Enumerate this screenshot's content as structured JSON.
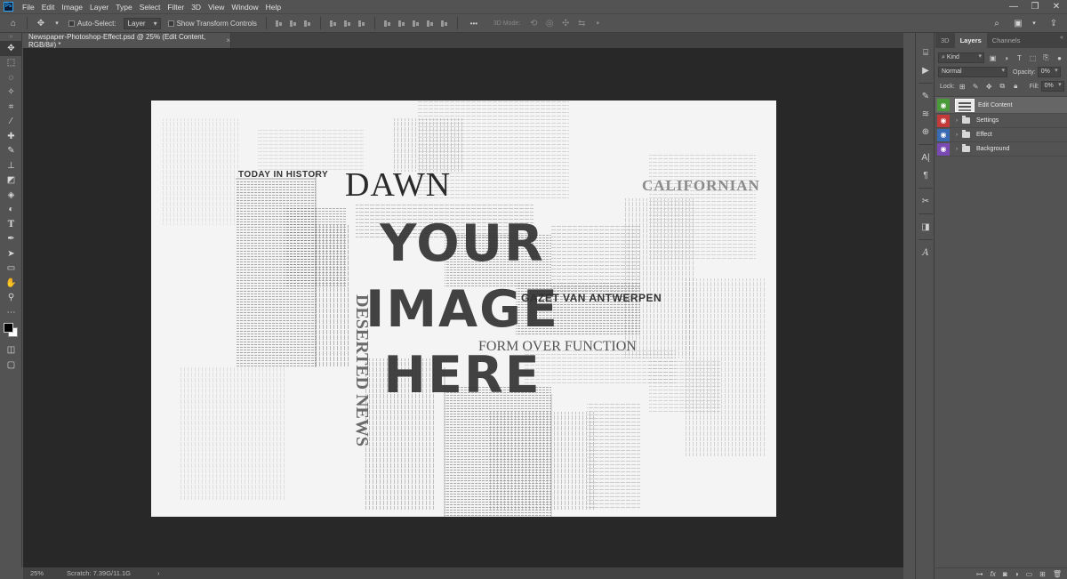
{
  "menu": {
    "app_logo": "Ps",
    "items": [
      "File",
      "Edit",
      "Image",
      "Layer",
      "Type",
      "Select",
      "Filter",
      "3D",
      "View",
      "Window",
      "Help"
    ],
    "window_controls": [
      "—",
      "❐",
      "✕"
    ]
  },
  "options_bar": {
    "auto_select_label": "Auto-Select:",
    "auto_select_target": "Layer",
    "show_transform_label": "Show Transform Controls",
    "mode_3d_label": "3D Mode:",
    "more_label": "•••"
  },
  "document": {
    "tab_title": "Newspaper-Photoshop-Effect.psd @ 25% (Edit Content, RGB/8#) *",
    "close_glyph": "×"
  },
  "canvas_text": {
    "headline_line1": "YOUR",
    "headline_line2": "IMAGE",
    "headline_line3": "HERE",
    "dawn": "DAWN",
    "today_in_history": "TODAY IN HISTORY",
    "californian": "CALIFORNIAN",
    "gazette": "GAZET VAN ANTWERPEN",
    "form_over_function": "FORM OVER FUNCTION",
    "deserted_news": "DESERTED NEWS"
  },
  "status_bar": {
    "zoom": "25%",
    "scratch": "Scratch: 7.39G/11.1G",
    "arrow": "›"
  },
  "layers_panel": {
    "tabs": [
      "3D",
      "Layers",
      "Channels"
    ],
    "active_tab": "Layers",
    "kind_filter": "Kind",
    "blend_mode": "Normal",
    "opacity_label": "Opacity:",
    "opacity_value": "0%",
    "lock_label": "Lock:",
    "fill_label": "Fill:",
    "fill_value": "0%",
    "layers": [
      {
        "name": "Edit Content",
        "type": "smart-object",
        "eye_color": "#4a9a3a",
        "selected": true
      },
      {
        "name": "Settings",
        "type": "group",
        "eye_color": "#c43a3a",
        "selected": false
      },
      {
        "name": "Effect",
        "type": "group",
        "eye_color": "#3a6ab4",
        "selected": false
      },
      {
        "name": "Background",
        "type": "group",
        "eye_color": "#7a4ab4",
        "selected": false
      }
    ],
    "collapse_arrows": "«"
  },
  "colors": {
    "ui_panel": "#535353",
    "canvas_background": "#282828",
    "paper": "#f3f3f3"
  }
}
